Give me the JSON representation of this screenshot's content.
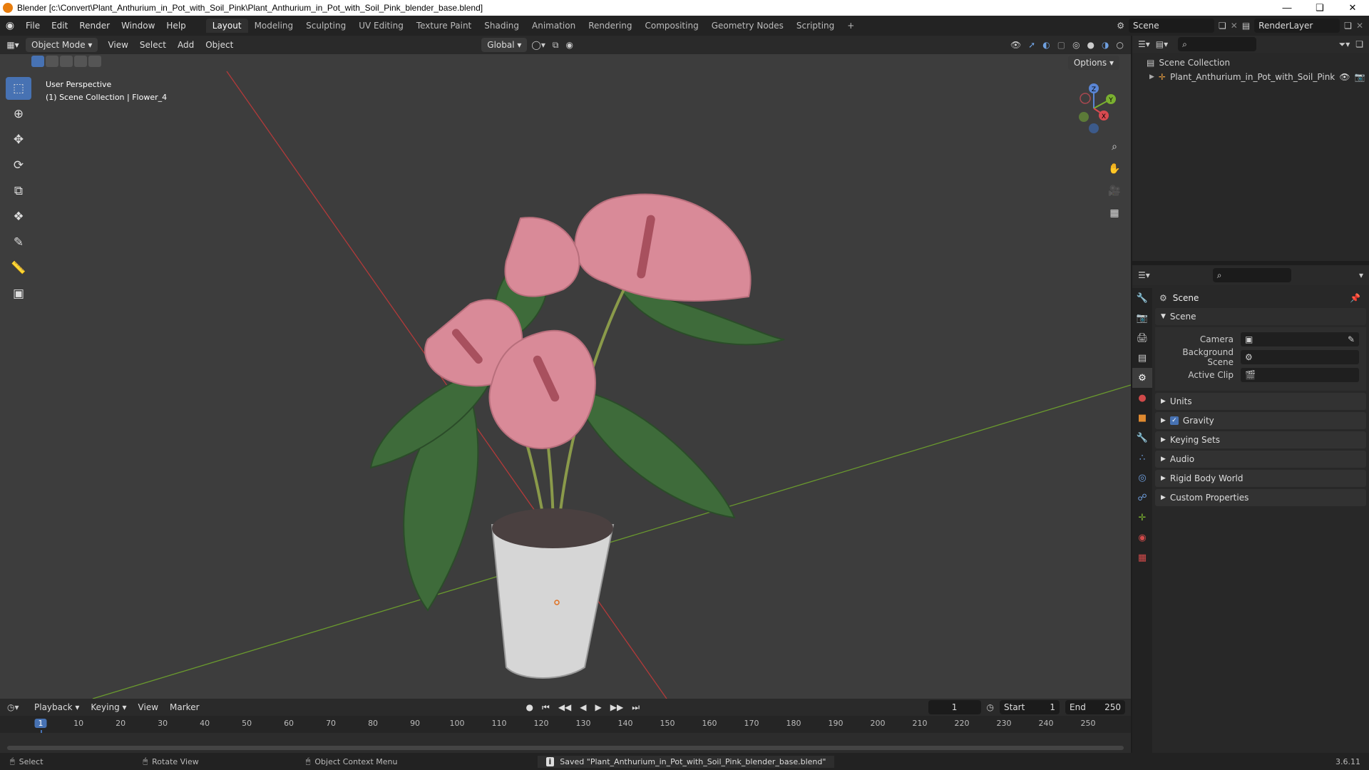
{
  "window": {
    "title": "Blender [c:\\Convert\\Plant_Anthurium_in_Pot_with_Soil_Pink\\Plant_Anthurium_in_Pot_with_Soil_Pink_blender_base.blend]"
  },
  "menus": [
    "File",
    "Edit",
    "Render",
    "Window",
    "Help"
  ],
  "workspaces": [
    "Layout",
    "Modeling",
    "Sculpting",
    "UV Editing",
    "Texture Paint",
    "Shading",
    "Animation",
    "Rendering",
    "Compositing",
    "Geometry Nodes",
    "Scripting"
  ],
  "active_workspace": "Layout",
  "scene_name": "Scene",
  "render_layer": "RenderLayer",
  "viewport_header": {
    "mode": "Object Mode",
    "menus": [
      "View",
      "Select",
      "Add",
      "Object"
    ],
    "orientation": "Global",
    "options": "Options"
  },
  "viewport": {
    "perspective": "User Perspective",
    "context": "(1) Scene Collection | Flower_4"
  },
  "gizmo_axes": {
    "x": "X",
    "y": "Y",
    "z": "Z"
  },
  "outliner": {
    "collection": "Scene Collection",
    "object": "Plant_Anthurium_in_Pot_with_Soil_Pink"
  },
  "properties": {
    "header": "Scene",
    "panel": "Scene",
    "fields": [
      {
        "label": "Camera"
      },
      {
        "label": "Background Scene"
      },
      {
        "label": "Active Clip"
      }
    ],
    "sections": [
      "Units",
      "Gravity",
      "Keying Sets",
      "Audio",
      "Rigid Body World",
      "Custom Properties"
    ],
    "gravity_checked": true
  },
  "timeline": {
    "menus": [
      "Playback",
      "Keying",
      "View",
      "Marker"
    ],
    "current_frame": "1",
    "start_label": "Start",
    "start": "1",
    "end_label": "End",
    "end": "250",
    "ticks": [
      "1",
      "10",
      "20",
      "30",
      "40",
      "50",
      "60",
      "70",
      "80",
      "90",
      "100",
      "110",
      "120",
      "130",
      "140",
      "150",
      "160",
      "170",
      "180",
      "190",
      "200",
      "210",
      "220",
      "230",
      "240",
      "250"
    ]
  },
  "status": {
    "select": "Select",
    "rotate": "Rotate View",
    "context_menu": "Object Context Menu",
    "message": "Saved \"Plant_Anthurium_in_Pot_with_Soil_Pink_blender_base.blend\"",
    "version": "3.6.11"
  },
  "colors": {
    "accent": "#4772b3",
    "x_axis": "#b33a3a",
    "y_axis": "#6a9a2e",
    "anthurium": "#d98a98",
    "leaf": "#3e6b3a"
  }
}
